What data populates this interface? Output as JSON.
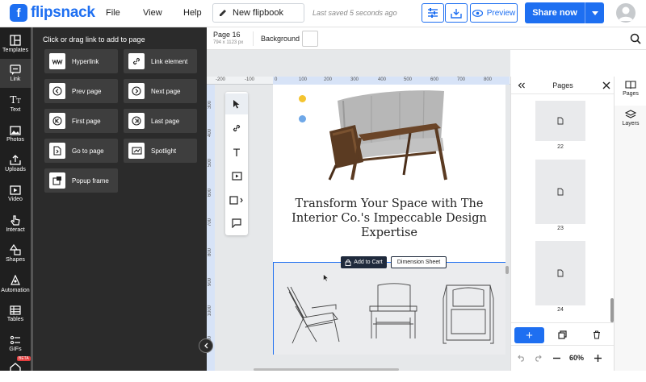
{
  "app": {
    "logo_text": "flipsnack",
    "logo_letter": "f"
  },
  "menu": {
    "file": "File",
    "view": "View",
    "help": "Help"
  },
  "doc": {
    "title": "New flipbook",
    "saved_status": "Last saved 5 seconds ago"
  },
  "header": {
    "preview_label": "Preview",
    "share_label": "Share now"
  },
  "leftnav": {
    "items": [
      {
        "label": "Templates"
      },
      {
        "label": "Link"
      },
      {
        "label": "Text"
      },
      {
        "label": "Photos"
      },
      {
        "label": "Uploads"
      },
      {
        "label": "Video"
      },
      {
        "label": "Interact"
      },
      {
        "label": "Shapes"
      },
      {
        "label": "Automation"
      },
      {
        "label": "Tables"
      },
      {
        "label": "GIFs"
      },
      {
        "label": "",
        "badge": "BETA"
      }
    ]
  },
  "link_panel": {
    "title": "Click or drag link to add to page",
    "tiles": [
      {
        "label": "Hyperlink",
        "icon": "www-icon"
      },
      {
        "label": "Link element",
        "icon": "link-icon"
      },
      {
        "label": "Prev page",
        "icon": "prev-page-icon"
      },
      {
        "label": "Next page",
        "icon": "next-page-icon"
      },
      {
        "label": "First page",
        "icon": "first-page-icon"
      },
      {
        "label": "Last page",
        "icon": "last-page-icon"
      },
      {
        "label": "Go to page",
        "icon": "go-to-page-icon"
      },
      {
        "label": "Spotlight",
        "icon": "spotlight-icon"
      },
      {
        "label": "Popup frame",
        "icon": "popup-frame-icon"
      }
    ]
  },
  "pagebar": {
    "page_label": "Page 16",
    "page_size": "794 x 1123 px",
    "background_label": "Background"
  },
  "rulers": {
    "h_ticks": [
      "-200",
      "-100",
      "0",
      "100",
      "200",
      "300",
      "400",
      "500",
      "600",
      "700",
      "800"
    ],
    "v_ticks": [
      "300",
      "400",
      "500",
      "600",
      "700",
      "800",
      "900",
      "1000",
      "1100"
    ]
  },
  "canvas": {
    "headline": "Transform Your Space with The Interior Co.'s Impeccable Design Expertise",
    "add_to_cart_label": "Add to Cart",
    "dimension_sheet_label": "Dimension Sheet",
    "accent_colors": {
      "yellow_dot": "#f4c430",
      "blue_dot": "#6fa8e8",
      "selection": "#1e6ff1"
    }
  },
  "pages_panel": {
    "title": "Pages",
    "thumbnails": [
      {
        "number": "22"
      },
      {
        "number": "23"
      },
      {
        "number": "24"
      }
    ],
    "zoom": "60%"
  },
  "rightnav": {
    "pages_label": "Pages",
    "layers_label": "Layers"
  },
  "colors": {
    "brand": "#1e6ff1",
    "nav_bg": "#1f1f1f",
    "panel_bg": "#2b2b2b"
  }
}
